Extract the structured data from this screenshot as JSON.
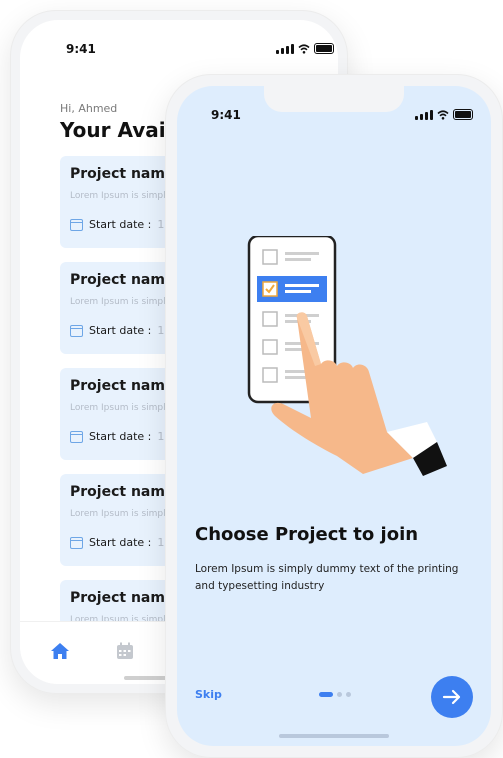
{
  "back_screen": {
    "status_time": "9:41",
    "greeting": "Hi, Ahmed",
    "title": "Your Availab",
    "projects": [
      {
        "name": "Project name",
        "description": "Lorem Ipsum is simply d and typesetting industr",
        "date_label": "Start date :",
        "date_value": "16 Ju"
      },
      {
        "name": "Project name",
        "description": "Lorem Ipsum is simply d and typesetting industr",
        "date_label": "Start date :",
        "date_value": "16 Ju"
      },
      {
        "name": "Project name",
        "description": "Lorem Ipsum is simply d and typesetting industr",
        "date_label": "Start date :",
        "date_value": "16 Ju"
      },
      {
        "name": "Project name",
        "description": "Lorem Ipsum is simply d and typesetting industr",
        "date_label": "Start date :",
        "date_value": "16 Ju"
      },
      {
        "name": "Project name",
        "description": "Lorem Ipsum is simply d and typesetting industr",
        "date_label": "",
        "date_value": ""
      }
    ],
    "nav_icons": [
      "home-icon",
      "calendar-icon"
    ]
  },
  "front_screen": {
    "status_time": "9:41",
    "title": "Choose Project to join",
    "description": "Lorem Ipsum is simply dummy text of the printing and typesetting industry",
    "skip_label": "Skip",
    "pagination": {
      "current": 1,
      "total": 3
    },
    "next_icon": "arrow-right-icon"
  },
  "colors": {
    "accent": "#3d7ff0",
    "front_background": "#deedfd",
    "card_background": "#e8f2fd",
    "hand": "#f6b88a"
  }
}
